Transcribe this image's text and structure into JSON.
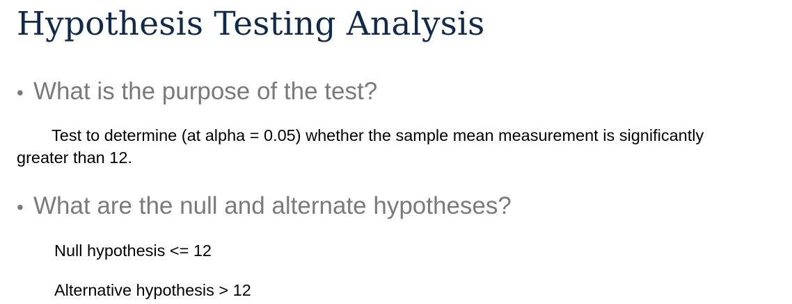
{
  "slide": {
    "title": "Hypothesis Testing Analysis",
    "bullet_symbol": "•",
    "sections": [
      {
        "question": "What is the purpose of the test?",
        "answer_lines": [
          "Test to determine (at alpha = 0.05) whether the sample mean measurement is significantly",
          "greater than 12."
        ]
      },
      {
        "question": "What are the null and alternate hypotheses?",
        "null_hypothesis": "Null hypothesis <= 12",
        "alternative_hypothesis": "Alternative hypothesis > 12"
      }
    ]
  },
  "colors": {
    "title": "#0f2a4e",
    "bullet_text": "#7a7a7a",
    "body_text": "#000000",
    "background": "#ffffff"
  }
}
